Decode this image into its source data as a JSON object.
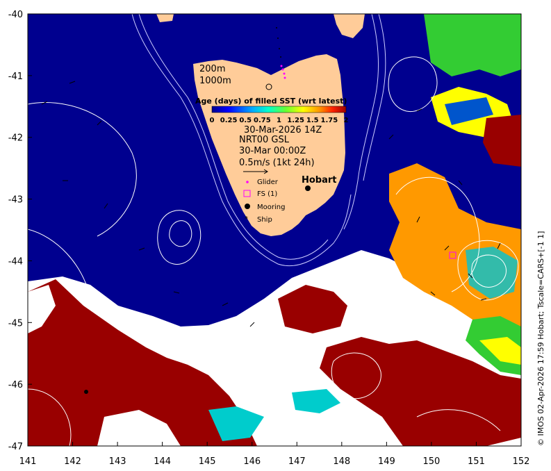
{
  "map": {
    "x_ticks": [
      "141",
      "142",
      "143",
      "144",
      "145",
      "146",
      "147",
      "148",
      "149",
      "150",
      "151",
      "152"
    ],
    "y_ticks": [
      "-40",
      "-41",
      "-42",
      "-43",
      "-44",
      "-45",
      "-46",
      "-47"
    ],
    "colors": {
      "ocean_deep": "#00008f",
      "land": "#ffcc99",
      "age_red": "#990000",
      "age_orange": "#ff9900",
      "age_yellow": "#ffff00",
      "age_green": "#33cc33",
      "age_cyan": "#00cccc",
      "age_blue": "#0055cc",
      "missing": "#ffffff"
    }
  },
  "legend": {
    "depth_200": "200m",
    "depth_1000": "1000m",
    "colorbar_title": "Age (days) of filled SST (wrt latest)",
    "colorbar_ticks": [
      "0",
      "0.25",
      "0.5",
      "0.75",
      "1",
      "1.25",
      "1.5",
      "1.75",
      "2"
    ],
    "date": "30-Mar-2026 14Z",
    "product": "NRT00 GSL",
    "current_time": "30-Mar 00:00Z",
    "scale": "0.5m/s (1kt 24h)",
    "glider": "Glider",
    "fs": "FS (1)",
    "mooring": "Mooring",
    "ship": "Ship"
  },
  "place": {
    "hobart": "Hobart"
  },
  "credit": "© IMOS 02-Apr-2026 17:59 Hobart; Tscale=CARS+[-1 1]"
}
